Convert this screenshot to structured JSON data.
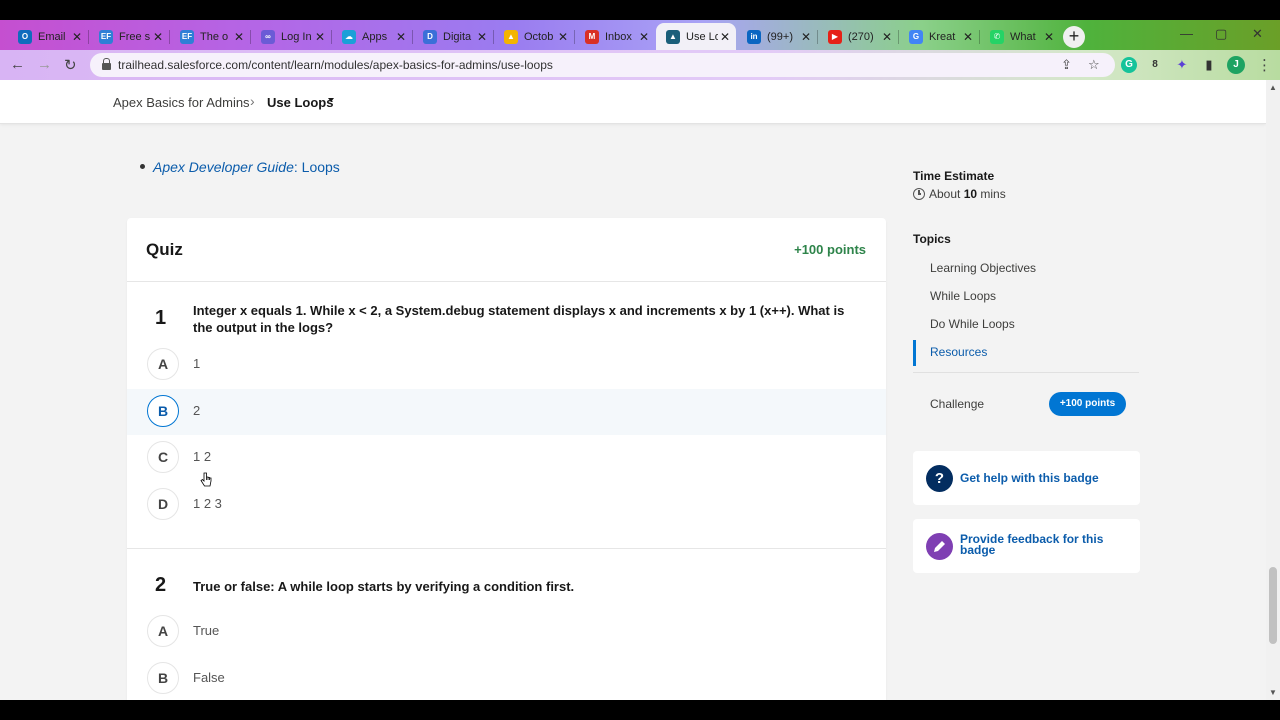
{
  "browser": {
    "tabs": [
      {
        "title": "Email",
        "icon": "outlook-icon",
        "color": "#0f6cbd",
        "glyph": "O"
      },
      {
        "title": "Free s",
        "icon": "ef-icon",
        "color": "#2f7fd6",
        "glyph": "EF"
      },
      {
        "title": "The o",
        "icon": "ef-icon",
        "color": "#2f7fd6",
        "glyph": "EF"
      },
      {
        "title": "Log In",
        "icon": "link-icon",
        "color": "#6b5bd6",
        "glyph": "∞"
      },
      {
        "title": "Apps",
        "icon": "apps-icon",
        "color": "#1aa0d8",
        "glyph": "☁"
      },
      {
        "title": "Digita",
        "icon": "digital-icon",
        "color": "#3b6fd8",
        "glyph": "D"
      },
      {
        "title": "Octob",
        "icon": "drive-icon",
        "color": "#f4b400",
        "glyph": "▲"
      },
      {
        "title": "Inbox",
        "icon": "gmail-icon",
        "color": "#d93025",
        "glyph": "M"
      },
      {
        "title": "Use Lo",
        "icon": "trailhead-icon",
        "color": "#1b5f7a",
        "glyph": "▲",
        "active": true
      },
      {
        "title": "(99+)",
        "icon": "linkedin-icon",
        "color": "#0a66c2",
        "glyph": "in"
      },
      {
        "title": "(270)",
        "icon": "youtube-icon",
        "color": "#e62117",
        "glyph": "▶"
      },
      {
        "title": "Kreat",
        "icon": "google-icon",
        "color": "#4285f4",
        "glyph": "G"
      },
      {
        "title": "What",
        "icon": "whatsapp-icon",
        "color": "#25d366",
        "glyph": "✆"
      }
    ],
    "new_tab": "+",
    "url": "trailhead.salesforce.com/content/learn/modules/apex-basics-for-admins/use-loops"
  },
  "breadcrumb": {
    "parent": "Apex Basics for Admins",
    "current": "Use Loops"
  },
  "resources": {
    "link_italic": "Apex Developer Guide",
    "link_rest": ": Loops"
  },
  "quiz": {
    "title": "Quiz",
    "points": "+100 points",
    "questions": [
      {
        "number": "1",
        "text": "Integer x equals 1. While x < 2, a System.debug statement displays x and increments x by 1 (x++). What is the output in the logs?",
        "options": [
          {
            "letter": "A",
            "text": "1"
          },
          {
            "letter": "B",
            "text": "2"
          },
          {
            "letter": "C",
            "text": "1 2"
          },
          {
            "letter": "D",
            "text": "1 2 3"
          }
        ]
      },
      {
        "number": "2",
        "text": "True or false: A while loop starts by verifying a condition first.",
        "options": [
          {
            "letter": "A",
            "text": "True"
          },
          {
            "letter": "B",
            "text": "False"
          }
        ]
      }
    ]
  },
  "sidebar": {
    "time_label": "Time Estimate",
    "time_prefix": "About ",
    "time_value": "10",
    "time_unit": " mins",
    "topics_label": "Topics",
    "topics": [
      "Learning Objectives",
      "While Loops",
      "Do While Loops",
      "Resources"
    ],
    "challenge_label": "Challenge",
    "challenge_points": "+100 points",
    "help_text": "Get help with this badge",
    "feedback_text": "Provide feedback for this badge"
  }
}
